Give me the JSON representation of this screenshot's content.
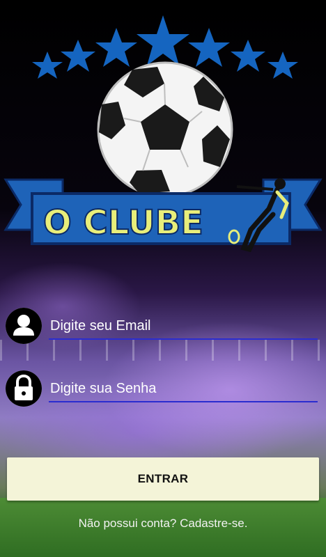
{
  "logo": {
    "text": "O CLUBE",
    "star_color": "#1565c0",
    "banner_color": "#1e63b8",
    "text_color": "#e8ee7a"
  },
  "login": {
    "email_placeholder": "Digite seu Email",
    "password_placeholder": "Digite sua Senha",
    "submit_label": "ENTRAR",
    "signup_text": "Não possui conta? Cadastre-se."
  },
  "icons": {
    "email": "user-icon",
    "password": "lock-icon"
  },
  "colors": {
    "underline": "#2a2ccf",
    "button_bg": "#f4f4d8"
  }
}
